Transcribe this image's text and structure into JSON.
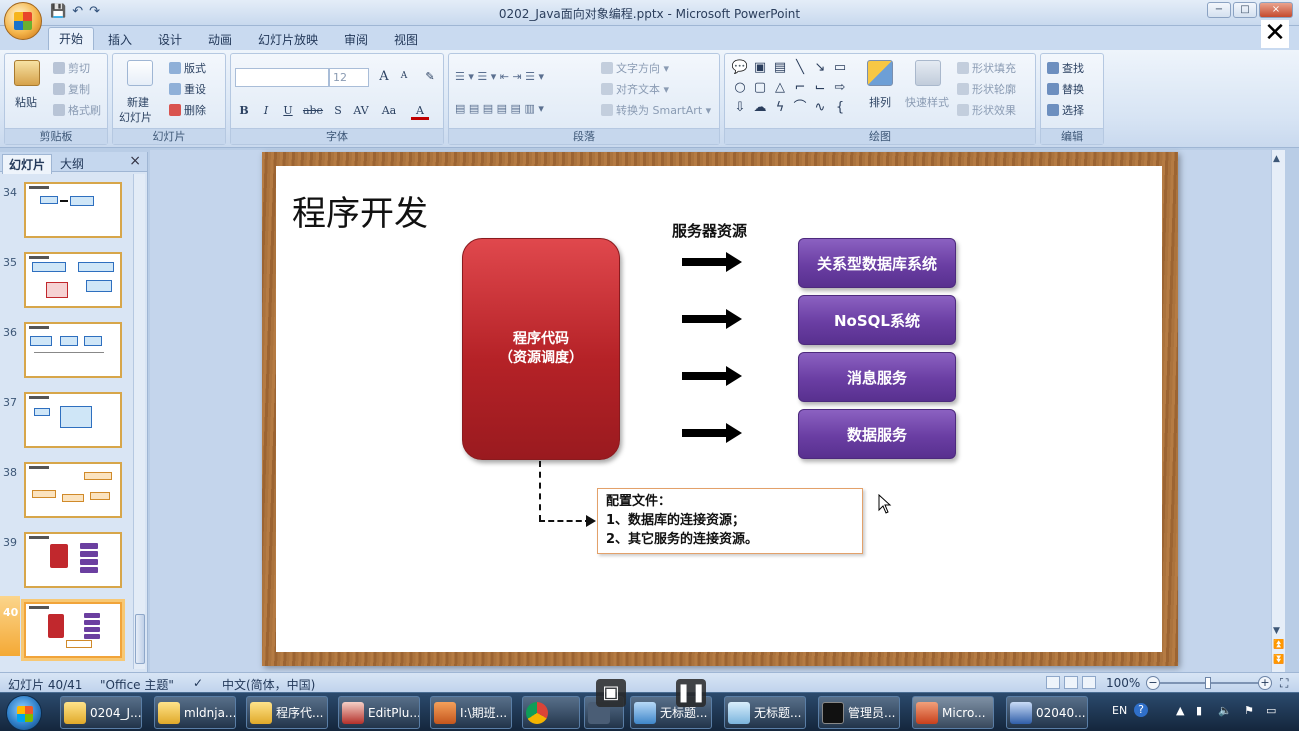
{
  "window": {
    "title": "0202_Java面向对象编程.pptx - Microsoft PowerPoint",
    "min": "−",
    "max": "□",
    "close": "×",
    "overlay_close": "✕"
  },
  "ribbon": {
    "tabs": [
      "开始",
      "插入",
      "设计",
      "动画",
      "幻灯片放映",
      "审阅",
      "视图"
    ],
    "clipboard": {
      "label": "剪贴板",
      "paste": "粘贴",
      "cut": "剪切",
      "copy": "复制",
      "format_painter": "格式刷"
    },
    "slides": {
      "label": "幻灯片",
      "new_slide_1": "新建",
      "new_slide_2": "幻灯片",
      "layout": "版式",
      "reset": "重设",
      "delete": "删除"
    },
    "font": {
      "label": "字体",
      "size": "12",
      "bold": "B",
      "italic": "I",
      "underline": "U",
      "strike": "abe",
      "shadow": "S",
      "spacing": "AV",
      "case": "Aa",
      "color": "A",
      "grow": "A",
      "shrink": "A"
    },
    "paragraph": {
      "label": "段落",
      "text_direction": "文字方向",
      "align_text": "对齐文本",
      "smartart": "转换为 SmartArt"
    },
    "drawing": {
      "label": "绘图",
      "arrange": "排列",
      "quick_styles": "快速样式",
      "shape_fill": "形状填充",
      "shape_outline": "形状轮廓",
      "shape_effects": "形状效果"
    },
    "editing": {
      "label": "编辑",
      "find": "查找",
      "replace": "替换",
      "select": "选择"
    }
  },
  "panel": {
    "tabs": [
      "幻灯片",
      "大纲"
    ],
    "close": "×",
    "slide_numbers": [
      "34",
      "35",
      "36",
      "37",
      "38",
      "39",
      "40"
    ]
  },
  "slide": {
    "title": "程序开发",
    "code_box_line1": "程序代码",
    "code_box_line2": "（资源调度）",
    "server_label": "服务器资源",
    "resources": [
      "关系型数据库系统",
      "NoSQL系统",
      "消息服务",
      "数据服务"
    ],
    "config_title": "配置文件：",
    "config_items": [
      "1、数据库的连接资源；",
      "2、其它服务的连接资源。"
    ]
  },
  "status": {
    "slide_count": "幻灯片 40/41",
    "theme": "\"Office 主题\"",
    "language": "中文(简体，中国)",
    "zoom": "100%"
  },
  "taskbar": {
    "items": [
      "0204_J...",
      "mldnja...",
      "程序代...",
      "EditPlu...",
      "I:\\期班...",
      "",
      "",
      "无标题...",
      "无标题...",
      "管理员...",
      "Micro...",
      "02040..."
    ],
    "tray": [
      "EN",
      "?",
      "▲"
    ]
  }
}
